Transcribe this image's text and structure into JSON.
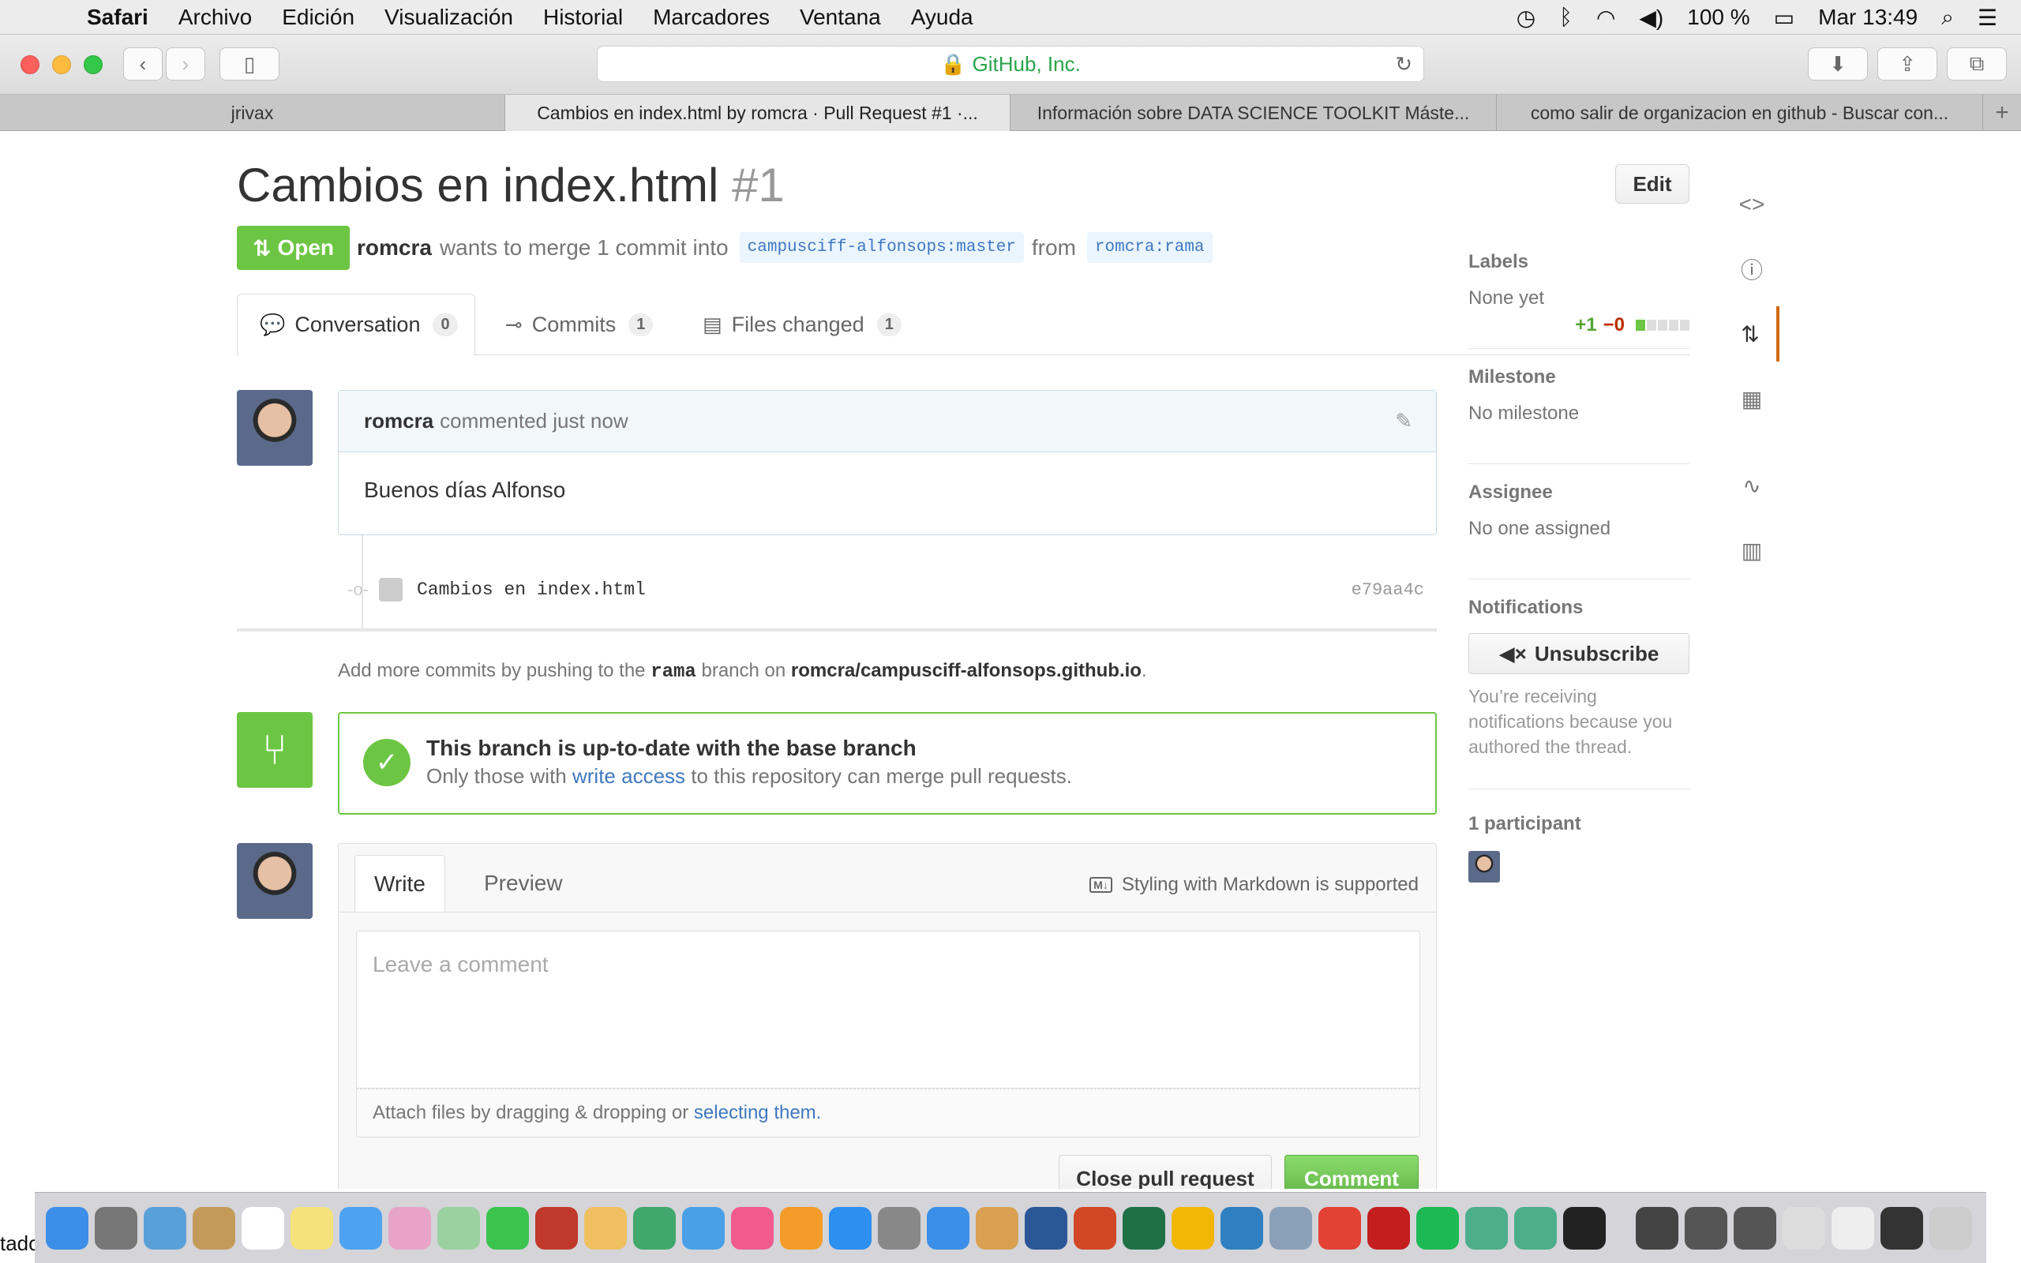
{
  "menubar": {
    "app": "Safari",
    "items": [
      "Archivo",
      "Edición",
      "Visualización",
      "Historial",
      "Marcadores",
      "Ventana",
      "Ayuda"
    ],
    "battery": "100 %",
    "clock": "Mar 13:49"
  },
  "browser": {
    "url_label": "GitHub, Inc.",
    "tabs": [
      "jrivax",
      "Cambios en index.html by romcra · Pull Request #1 ·...",
      "Información sobre DATA SCIENCE TOOLKIT Máste...",
      "como salir de organizacion en github - Buscar con..."
    ],
    "new_tab": "+"
  },
  "pr": {
    "title": "Cambios en index.html",
    "number": "#1",
    "edit_label": "Edit",
    "state": "Open",
    "author": "romcra",
    "meta_text": "wants to merge 1 commit into",
    "base_ref": "campusciff-alfonsops:master",
    "from_text": "from",
    "head_ref": "romcra:rama",
    "tabs": {
      "conversation": "Conversation",
      "conversation_count": "0",
      "commits": "Commits",
      "commits_count": "1",
      "files": "Files changed",
      "files_count": "1"
    },
    "diffstat_add": "+1",
    "diffstat_del": "−0"
  },
  "comment": {
    "author": "romcra",
    "action": "commented just now",
    "body": "Buenos días Alfonso"
  },
  "commit": {
    "message": "Cambios en index.html",
    "sha": "e79aa4c"
  },
  "help": {
    "prefix": "Add more commits by pushing to the",
    "branch": "rama",
    "middle": "branch on",
    "repo": "romcra/campusciff-alfonsops.github.io",
    "suffix": "."
  },
  "merge": {
    "heading": "This branch is up-to-date with the base branch",
    "sub_prefix": "Only those with",
    "sub_link": "write access",
    "sub_suffix": "to this repository can merge pull requests."
  },
  "form": {
    "write": "Write",
    "preview": "Preview",
    "markdown": "Styling with Markdown is supported",
    "placeholder": "Leave a comment",
    "attach_prefix": "Attach files by dragging & dropping or",
    "attach_link": "selecting them.",
    "close_button": "Close pull request",
    "comment_button": "Comment"
  },
  "sidebar": {
    "labels_h": "Labels",
    "labels_v": "None yet",
    "milestone_h": "Milestone",
    "milestone_v": "No milestone",
    "assignee_h": "Assignee",
    "assignee_v": "No one assigned",
    "notifications_h": "Notifications",
    "unsubscribe": "Unsubscribe",
    "reason": "You’re receiving notifications because you authored the thread.",
    "participants_h": "1 participant"
  },
  "desktop": {
    "left_edge_text": "tado"
  }
}
